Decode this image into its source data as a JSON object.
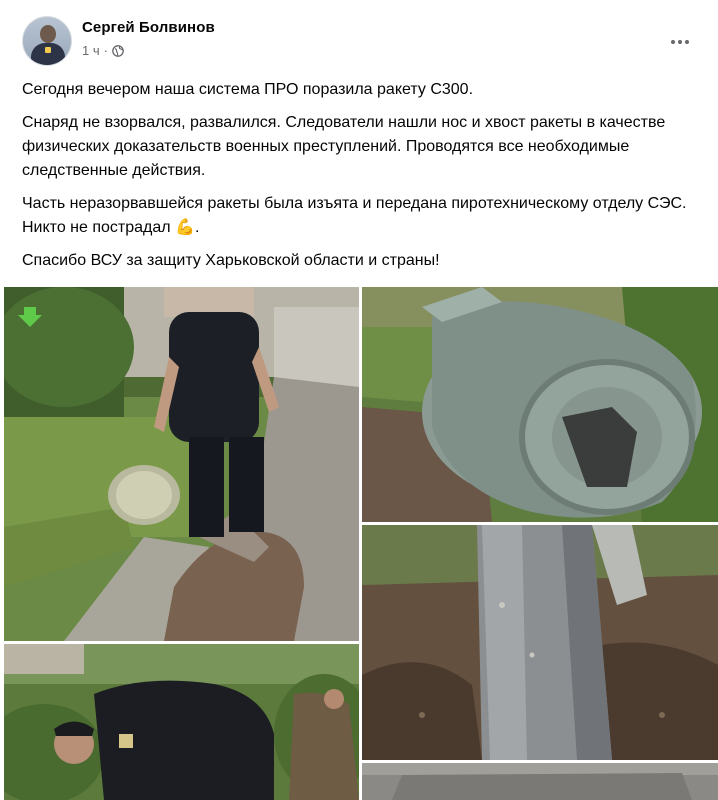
{
  "post": {
    "author_name": "Сергей Болвинов",
    "time": "1 ч",
    "separator": "·",
    "paragraphs": [
      "Сегодня вечером наша система ПРО поразила ракету С300.",
      "Снаряд не взорвался, развалился. Следователи нашли нос и хвост ракеты в качестве физических доказательств военных преступлений. Проводятся все необходимые следственные действия.",
      "Часть неразорвавшейся ракеты была изъята и передана пиротехническому отделу СЭС. Никто не пострадал 💪.",
      "Спасибо ВСУ за защиту Харьковской области и страны!"
    ]
  },
  "icons": {
    "audience": "globe-icon",
    "more": "more-options-icon",
    "arrow": "down-arrow-icon"
  },
  "colors": {
    "text_primary": "#050505",
    "text_secondary": "#65676b",
    "background": "#ffffff",
    "arrow_green": "#5fc94a"
  }
}
